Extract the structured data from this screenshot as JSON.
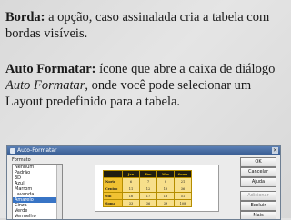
{
  "paragraphs": {
    "borda_term": "Borda:",
    "borda_text": " a opção, caso assinalada cria a tabela com bordas visíveis.",
    "auto_term": "Auto Formatar:",
    "auto_text1": " ícone que abre a caixa de diálogo ",
    "auto_italic": "Auto Formatar",
    "auto_text2": ", onde você pode selecionar um Layout predefinido para a tabela."
  },
  "dialog": {
    "title": "Auto-Formatar",
    "group_label": "Formato",
    "formats": [
      "Nenhum",
      "Padrão",
      "3D",
      "Azul",
      "Marrom",
      "Lavanda",
      "Amarelo",
      "Cinza",
      "Verde",
      "Vermelho",
      "Preto 1",
      "Preto 2"
    ],
    "selected_format": "Amarelo",
    "buttons": {
      "ok": "OK",
      "cancel": "Cancelar",
      "help": "Ajuda",
      "add": "Adicionar",
      "delete": "Excluir",
      "more": "Mais"
    },
    "preview": {
      "headers": [
        "",
        "Jan",
        "Fev",
        "Mar",
        "Soma"
      ],
      "rows": [
        [
          "Norte",
          "6",
          "7",
          "8",
          "21"
        ],
        [
          "Centro",
          "11",
          "12",
          "13",
          "36"
        ],
        [
          "Sul",
          "16",
          "17",
          "18",
          "51"
        ],
        [
          "Soma",
          "33",
          "36",
          "39",
          "108"
        ]
      ]
    }
  }
}
